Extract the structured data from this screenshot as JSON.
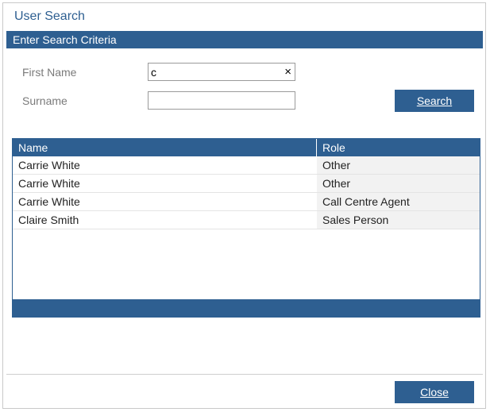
{
  "dialog": {
    "title": "User Search",
    "section_header": "Enter Search Criteria"
  },
  "form": {
    "first_name_label": "First Name",
    "first_name_value": "c",
    "surname_label": "Surname",
    "surname_value": "",
    "clear_icon": "×",
    "search_button": "Search"
  },
  "grid": {
    "columns": [
      "Name",
      "Role"
    ],
    "rows": [
      {
        "name": "Carrie White",
        "role": "Other"
      },
      {
        "name": "Carrie White",
        "role": "Other"
      },
      {
        "name": "Carrie White",
        "role": "Call Centre Agent"
      },
      {
        "name": "Claire Smith",
        "role": "Sales Person"
      }
    ]
  },
  "footer": {
    "close_button": "Close"
  },
  "colors": {
    "accent": "#2e5f91",
    "title_text": "#2e5f91",
    "label_text": "#7a7a7a"
  }
}
